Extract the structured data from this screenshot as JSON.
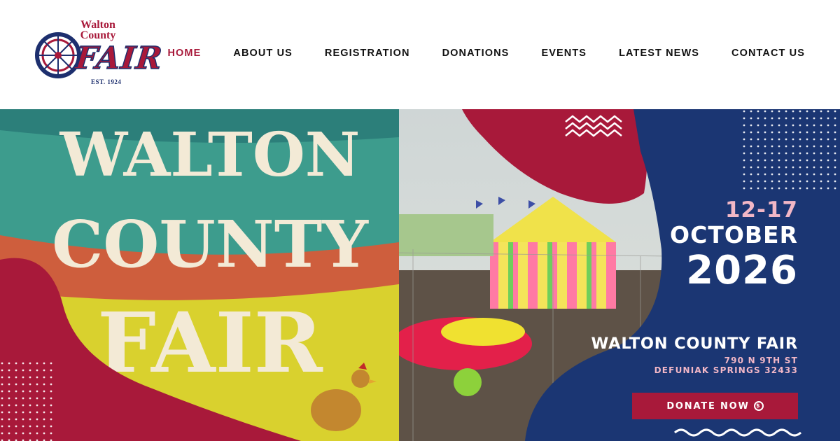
{
  "logo": {
    "top_text": "Walton County",
    "word": "FAIR",
    "est": "EST. 1924"
  },
  "nav": {
    "items": [
      {
        "label": "HOME",
        "active": true
      },
      {
        "label": "ABOUT US"
      },
      {
        "label": "REGISTRATION"
      },
      {
        "label": "DONATIONS"
      },
      {
        "label": "EVENTS"
      },
      {
        "label": "LATEST NEWS"
      },
      {
        "label": "CONTACT US"
      }
    ]
  },
  "hero": {
    "mural": {
      "line1": "WALTON",
      "line2": "COUNTY",
      "line3": "FAIR"
    },
    "dates": "12-17",
    "month": "OCTOBER",
    "year": "2026",
    "fair_name": "WALTON COUNTY FAIR",
    "address_line1": "790 N 9TH ST",
    "address_line2": "DEFUNIAK SPRINGS 32433",
    "donate_label": "DONATE NOW",
    "donate_icon": "coin-icon"
  },
  "colors": {
    "brand_red": "#a8193a",
    "brand_blue": "#1b3673",
    "accent_pink": "#f2b7c6"
  }
}
